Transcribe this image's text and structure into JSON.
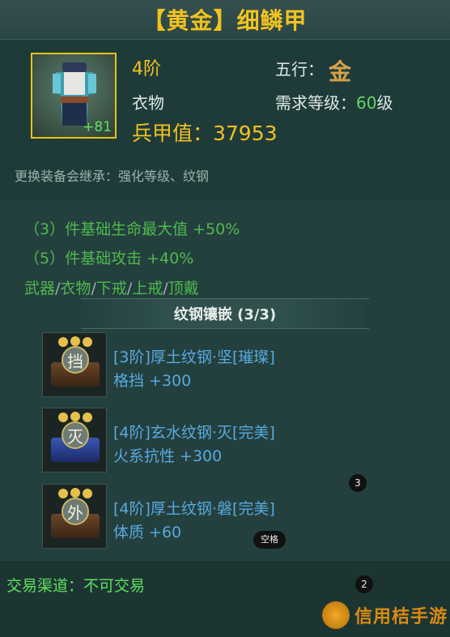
{
  "item": {
    "title": "【黄金】细鳞甲",
    "plus_level": "+81",
    "tier": "4阶",
    "category": "衣物",
    "wuxing_label": "五行：",
    "wuxing_value": "金",
    "require_label": "需求等级：",
    "require_level": "60",
    "require_unit": "级",
    "power": "兵甲值：37953",
    "inherit_note": "更换装备会继承：强化等级、纹钢"
  },
  "set_bonus": [
    {
      "text": "（3）件基础生命最大值 +50%"
    },
    {
      "text": "（5）件基础攻击 +40%"
    }
  ],
  "parts": [
    "武器",
    "衣物",
    "下戒",
    "上戒",
    "顶戴"
  ],
  "parts_separator": "/",
  "inlay": {
    "header": "纹钢镶嵌 (3/3)",
    "gems": [
      {
        "glyph": "挡",
        "name": "[3阶]厚土纹钢·坚[璀璨]",
        "stat": "格挡 +300",
        "color": "#5a3a22"
      },
      {
        "glyph": "灭",
        "name": "[4阶]玄水纹钢·灭[完美]",
        "stat": "火系抗性 +300",
        "color": "#2b3f8a"
      },
      {
        "glyph": "外",
        "name": "[4阶]厚土纹钢·磐[完美]",
        "stat": "体质 +60",
        "color": "#5a3a22"
      }
    ]
  },
  "overlay": {
    "badge_3": "3",
    "badge_space": "空格",
    "badge_2": "2"
  },
  "trade": "交易渠道：不可交易",
  "watermark": "信用桔手游"
}
